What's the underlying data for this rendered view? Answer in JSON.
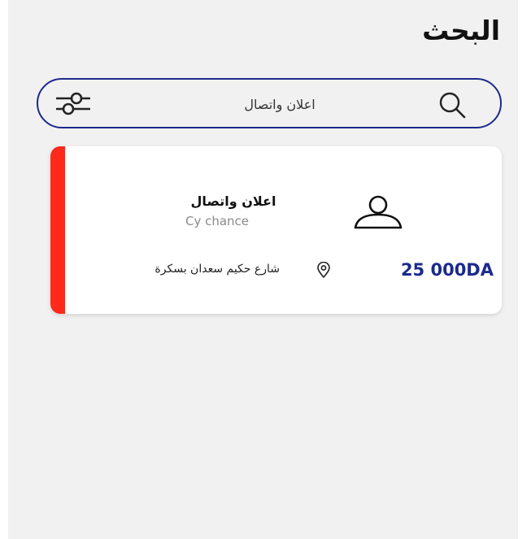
{
  "header": {
    "title": "البحث"
  },
  "search": {
    "value": "اعلان واتصال",
    "placeholder": "",
    "icons": {
      "search": "search-icon",
      "filter": "filter-sliders-icon"
    }
  },
  "results": [
    {
      "name": "اعلان واتصال",
      "company": "Cy chance",
      "address": "شارع حكيم سعدان بسكرة",
      "price": "25 000DA",
      "icons": {
        "avatar": "user-avatar-icon",
        "location": "location-pin-icon"
      }
    }
  ],
  "colors": {
    "accent": "#1c2a8c",
    "card_stripe": "#ff2a1a",
    "background": "#f1f1f1"
  }
}
